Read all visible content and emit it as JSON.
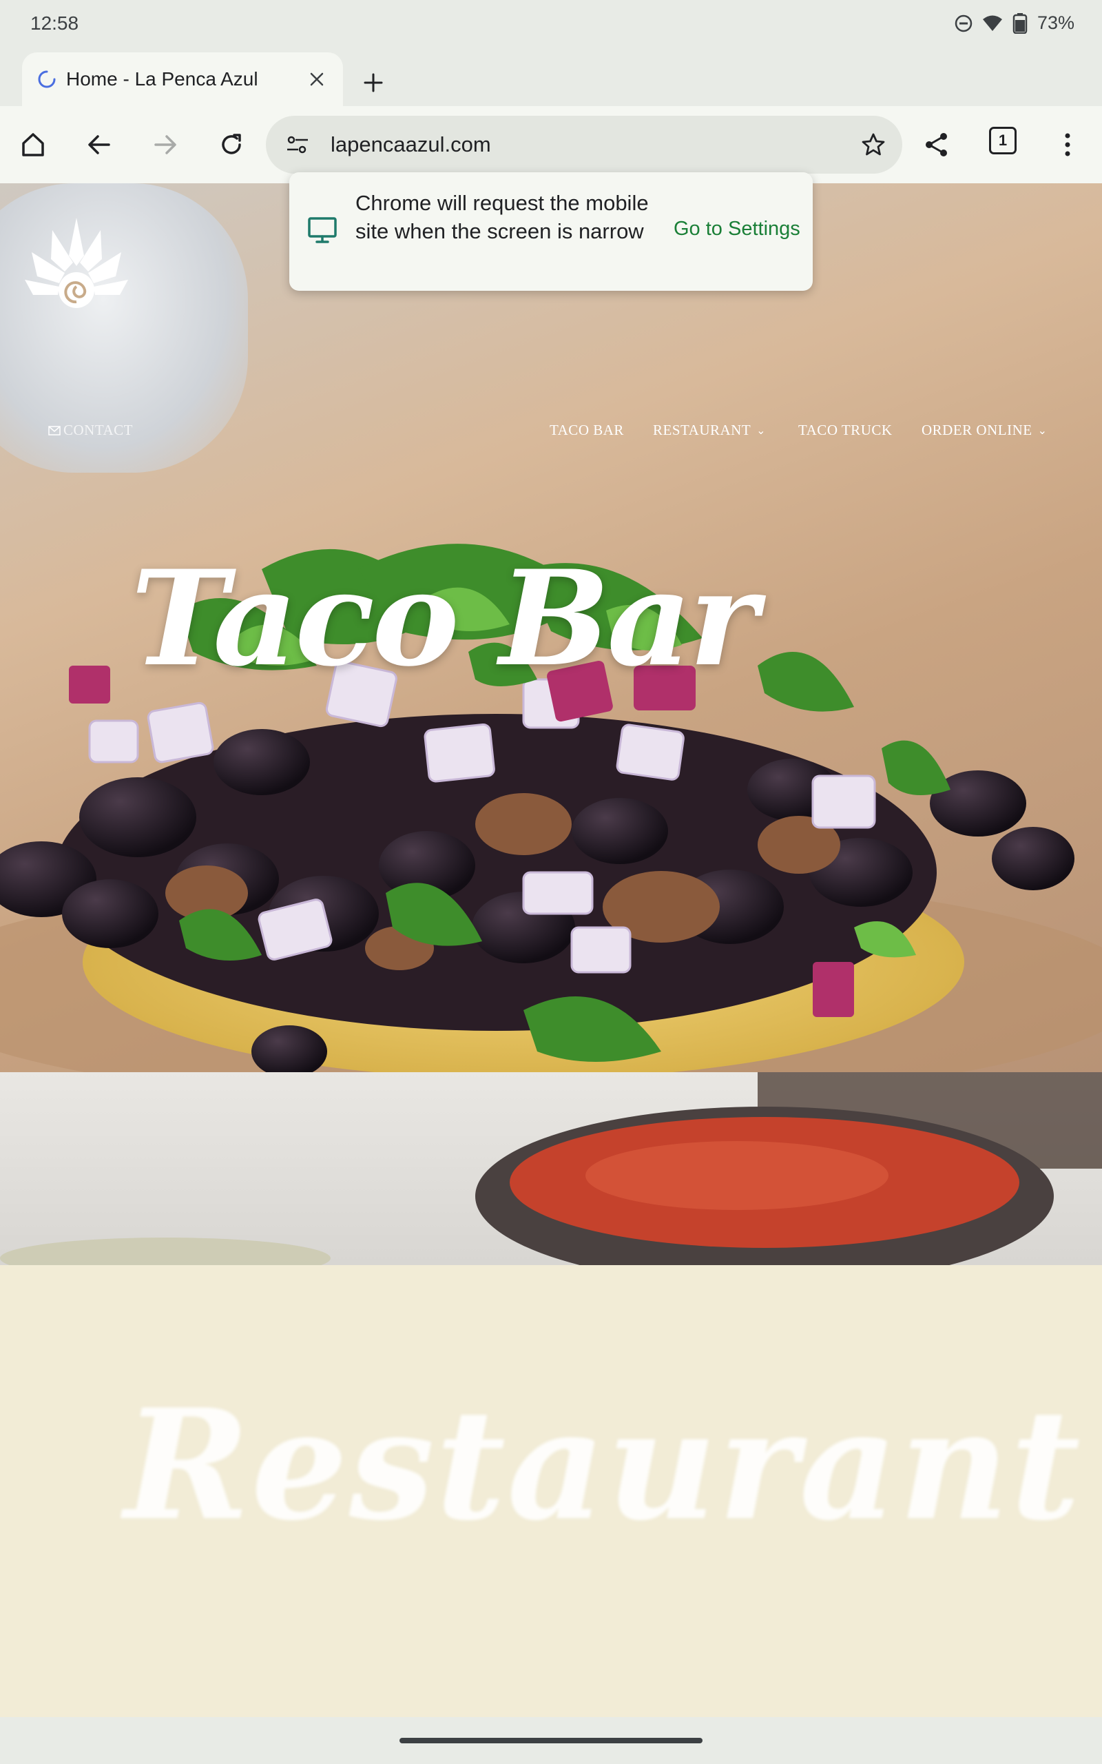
{
  "status_bar": {
    "time": "12:58",
    "battery": "73%"
  },
  "tab": {
    "title": "Home - La Penca Azul"
  },
  "omnibox": {
    "url": "lapencaazul.com"
  },
  "tab_count": "1",
  "popup": {
    "message": "Chrome will request the mobile site when the screen is narrow",
    "action": "Go to Settings"
  },
  "site_nav": {
    "contact": "CONTACT",
    "items": [
      {
        "label": "TACO BAR",
        "caret": ""
      },
      {
        "label": "RESTAURANT",
        "caret": "⌄"
      },
      {
        "label": "TACO TRUCK",
        "caret": ""
      },
      {
        "label": "ORDER ONLINE",
        "caret": "⌄"
      }
    ]
  },
  "hero": {
    "title": "Taco Bar"
  },
  "restaurant": {
    "title": "Restaurant"
  }
}
